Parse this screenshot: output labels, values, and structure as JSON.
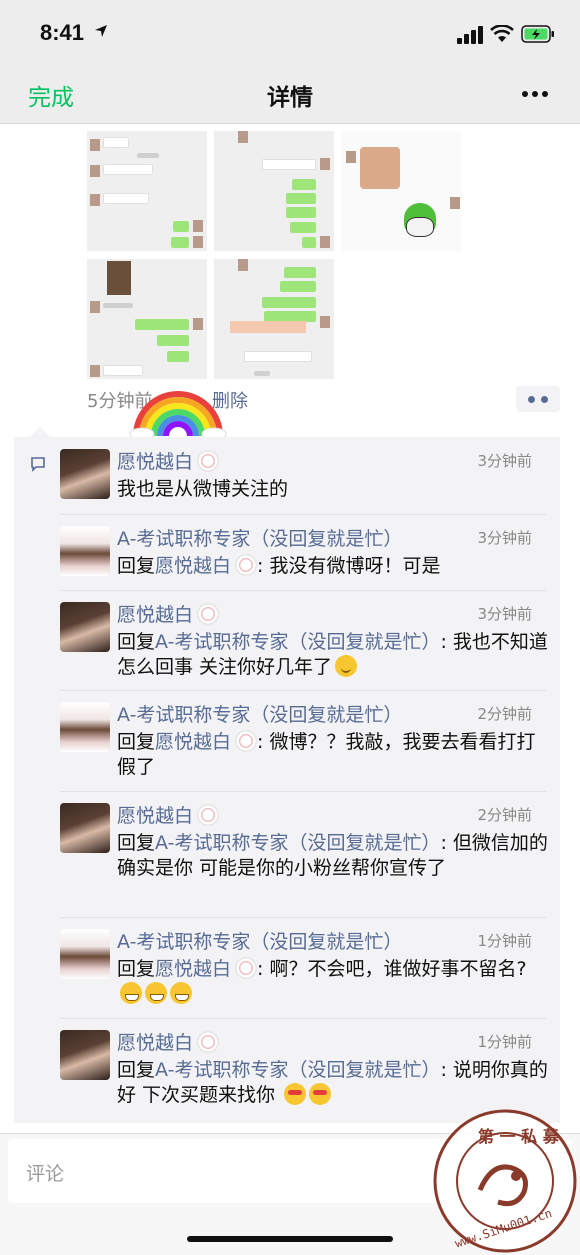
{
  "status_bar": {
    "time": "8:41"
  },
  "nav": {
    "done": "完成",
    "title": "详情"
  },
  "post": {
    "time": "5分钟前",
    "delete": "删除"
  },
  "comments": [
    {
      "name": "愿悦越白",
      "time": "3分钟前",
      "prefix": "",
      "reply_to": "",
      "text": "我也是从微博关注的",
      "emojis": []
    },
    {
      "name": "A-考试职称专家（没回复就是忙）",
      "time": "3分钟前",
      "prefix": "回复",
      "reply_to": "愿悦越白",
      "text": ": 我没有微博呀！可是",
      "emojis": []
    },
    {
      "name": "愿悦越白",
      "time": "3分钟前",
      "prefix": "回复",
      "reply_to": "A-考试职称专家（没回复就是忙）",
      "text": ": 我也不知道怎么回事  关注你好几年了",
      "emojis": [
        "smile"
      ]
    },
    {
      "name": "A-考试职称专家（没回复就是忙）",
      "time": "2分钟前",
      "prefix": "回复",
      "reply_to": "愿悦越白",
      "text": ": 微博？？我敲，我要去看看打打假了",
      "emojis": []
    },
    {
      "name": "愿悦越白",
      "time": "2分钟前",
      "prefix": "回复",
      "reply_to": "A-考试职称专家（没回复就是忙）",
      "text": ": 但微信加的确实是你  可能是你的小粉丝帮你宣传了",
      "emojis": []
    },
    {
      "name": "A-考试职称专家（没回复就是忙）",
      "time": "1分钟前",
      "prefix": "回复",
      "reply_to": "愿悦越白",
      "text": ": 啊？不会吧，谁做好事不留名?",
      "emojis": [
        "grin",
        "grin",
        "grin"
      ]
    },
    {
      "name": "愿悦越白",
      "time": "1分钟前",
      "prefix": "回复",
      "reply_to": "A-考试职称专家（没回复就是忙）",
      "text": ": 说明你真的好 下次买题来找你 ",
      "emojis": [
        "heart",
        "heart"
      ]
    }
  ],
  "input": {
    "placeholder": "评论"
  },
  "watermark": {
    "top": "第一私募",
    "bottom": "www.SiMu001.cn"
  },
  "colors": {
    "accent": "#07c160",
    "link": "#576b95",
    "nav_bg": "#ededed",
    "comment_bg": "#f3f3f5"
  }
}
